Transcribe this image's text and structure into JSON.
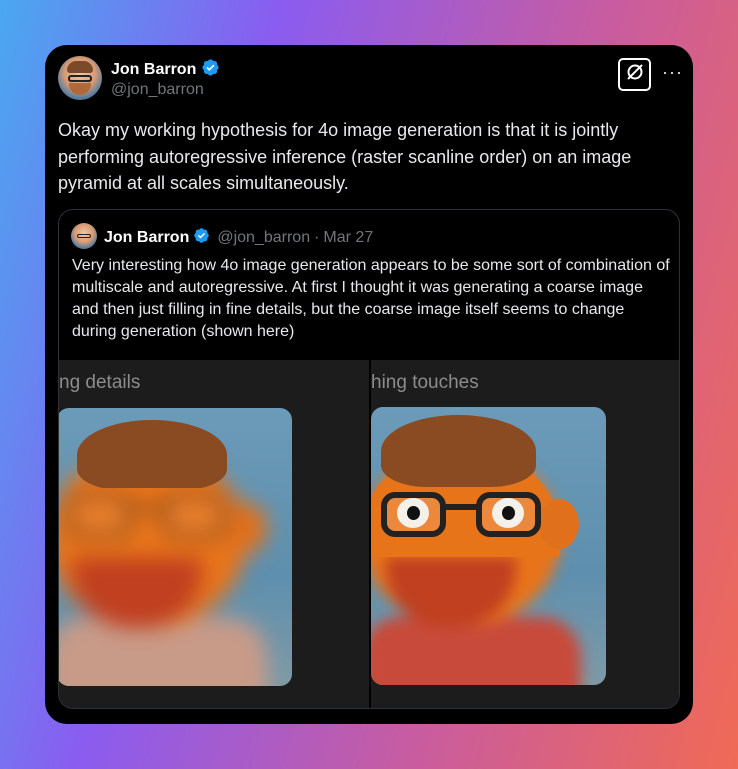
{
  "tweet": {
    "author_name": "Jon Barron",
    "author_handle": "@jon_barron",
    "text": "Okay my working hypothesis for 4o image generation is that it is jointly performing autoregressive inference (raster scanline order) on an image pyramid at all scales simultaneously.",
    "more_label": "···"
  },
  "quoted": {
    "author_name": "Jon Barron",
    "author_handle": "@jon_barron",
    "separator": "·",
    "date": "Mar 27",
    "text": "Very interesting how 4o image generation appears to be some sort of combination of multiscale and autoregressive. At first I thought it was generating a coarse image and then just filling in fine details, but the coarse image itself seems to change during generation (shown here)",
    "media": {
      "left_caption": "ng details",
      "right_caption": "hing touches"
    }
  },
  "icons": {
    "verified": "verified-badge-icon",
    "grok": "grok-icon",
    "more": "more-icon"
  },
  "colors": {
    "verified_blue": "#1d9bf0",
    "card_bg": "#000000",
    "muted_text": "#71767b"
  }
}
